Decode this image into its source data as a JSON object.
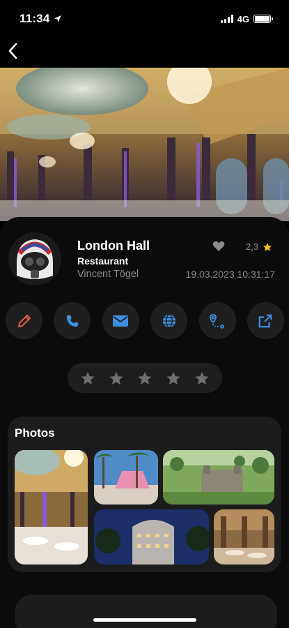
{
  "status_bar": {
    "time": "11:34",
    "network": "4G"
  },
  "place": {
    "name": "London Hall",
    "category": "Restaurant",
    "author": "Vincent Tögel",
    "rating": "2,3",
    "timestamp": "19.03.2023 10:31:17"
  },
  "actions": [
    {
      "icon": "pencil-icon",
      "color": "#e05a47"
    },
    {
      "icon": "phone-icon",
      "color": "#3d8fe0"
    },
    {
      "icon": "mail-icon",
      "color": "#3d8fe0"
    },
    {
      "icon": "globe-icon",
      "color": "#3d8fe0"
    },
    {
      "icon": "route-icon",
      "color": "#3d8fe0"
    },
    {
      "icon": "external-link-icon",
      "color": "#3d8fe0"
    }
  ],
  "rating_stars": {
    "count": 5,
    "filled": 0
  },
  "photos": {
    "heading": "Photos",
    "count": 5
  },
  "colors": {
    "accent_red": "#e05a47",
    "accent_blue": "#3d8fe0",
    "star_gold": "#f5c518"
  }
}
